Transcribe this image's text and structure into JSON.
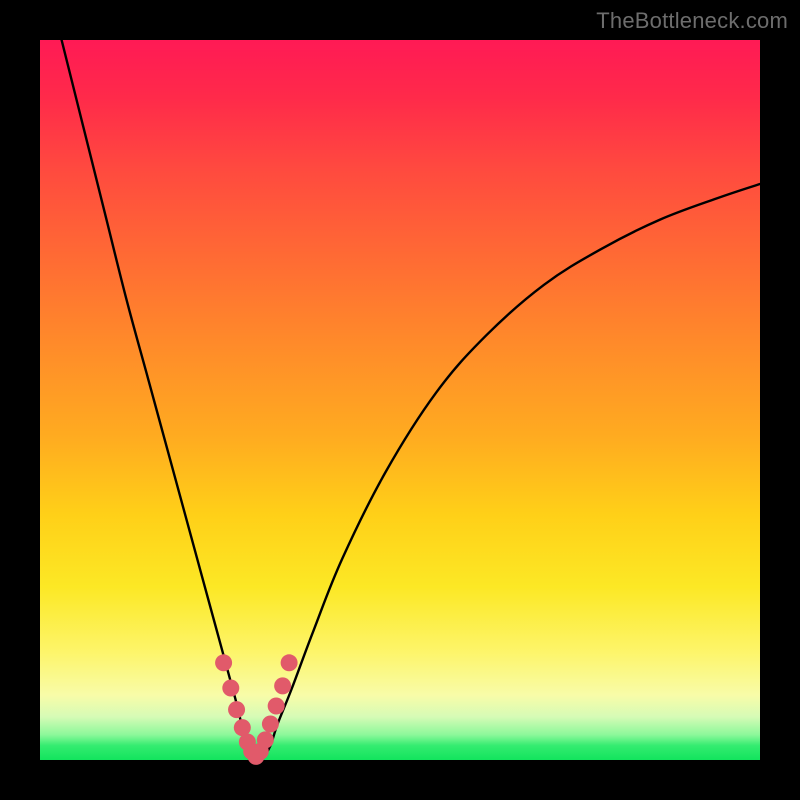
{
  "watermark": "TheBottleneck.com",
  "chart_data": {
    "type": "line",
    "title": "",
    "xlabel": "",
    "ylabel": "",
    "xlim": [
      0,
      100
    ],
    "ylim": [
      0,
      100
    ],
    "series": [
      {
        "name": "bottleneck-curve",
        "x": [
          3,
          6,
          9,
          12,
          15,
          18,
          21,
          24,
          27,
          28,
          29,
          30,
          31,
          32,
          33,
          35,
          38,
          42,
          48,
          55,
          62,
          70,
          78,
          86,
          94,
          100
        ],
        "y": [
          100,
          88,
          76,
          64,
          53,
          42,
          31,
          20,
          9,
          5,
          2,
          0.5,
          0.5,
          2,
          5,
          10,
          18,
          28,
          40,
          51,
          59,
          66,
          71,
          75,
          78,
          80
        ]
      }
    ],
    "marker_segment": {
      "name": "highlight-pink",
      "color": "#e15a6a",
      "x": [
        25.5,
        26.5,
        27.3,
        28.1,
        28.8,
        29.4,
        30.0,
        30.6,
        31.3,
        32.0,
        32.8,
        33.7,
        34.6
      ],
      "y": [
        13.5,
        10.0,
        7.0,
        4.5,
        2.5,
        1.2,
        0.5,
        1.2,
        2.8,
        5.0,
        7.5,
        10.3,
        13.5
      ]
    }
  }
}
